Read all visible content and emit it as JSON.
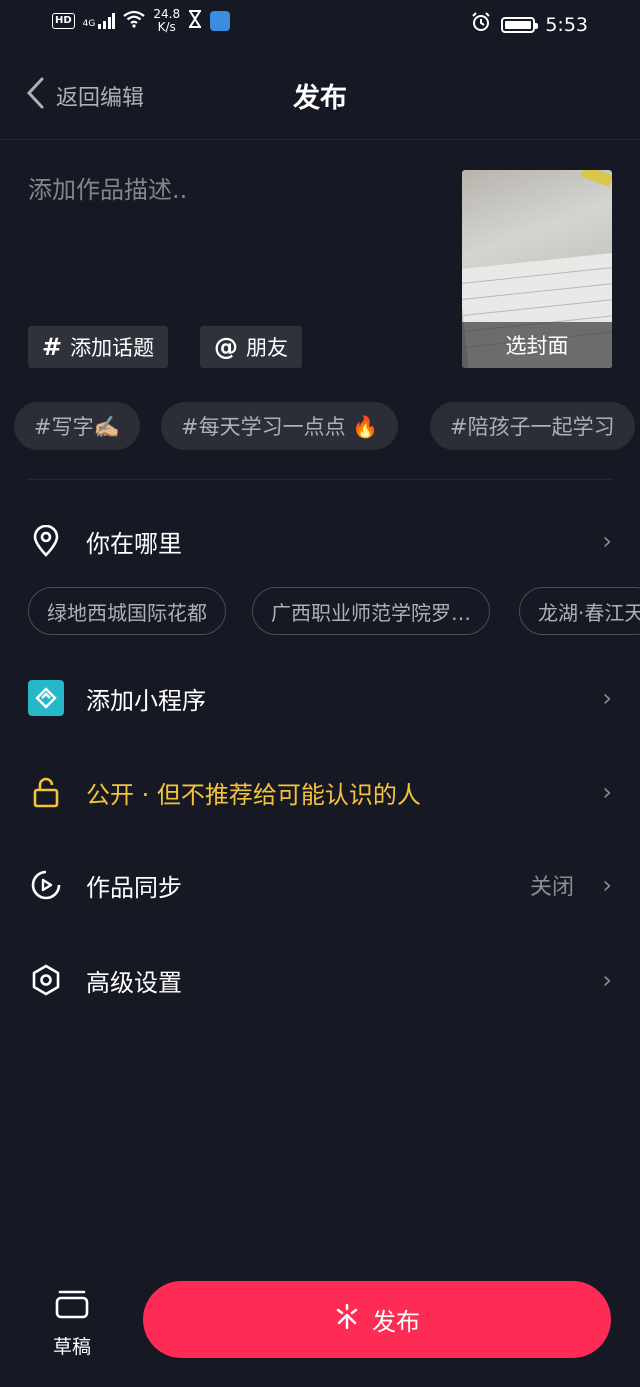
{
  "status_bar": {
    "hd": "HD",
    "network": "4G",
    "speed_value": "24.8",
    "speed_unit": "K/s",
    "time": "5:53"
  },
  "header": {
    "back_label": "返回编辑",
    "title": "发布"
  },
  "description": {
    "placeholder": "添加作品描述.."
  },
  "actions": {
    "topic_icon": "#",
    "topic_label": "添加话题",
    "friend_icon": "@",
    "friend_label": "朋友"
  },
  "cover": {
    "label": "选封面"
  },
  "topics": [
    "#写字✍🏼",
    "#每天学习一点点 🔥",
    "#陪孩子一起学习"
  ],
  "location": {
    "label": "你在哪里",
    "suggestions": [
      "绿地西城国际花都",
      "广西职业师范学院罗…",
      "龙湖·春江天"
    ]
  },
  "mini_program": {
    "label": "添加小程序"
  },
  "privacy": {
    "label": "公开 · 但不推荐给可能认识的人",
    "color": "#f5c33b"
  },
  "sync": {
    "label": "作品同步",
    "value": "关闭"
  },
  "advanced": {
    "label": "高级设置"
  },
  "bottom": {
    "draft_label": "草稿",
    "publish_label": "发布",
    "publish_color": "#fe2c55"
  },
  "chevron": "›"
}
